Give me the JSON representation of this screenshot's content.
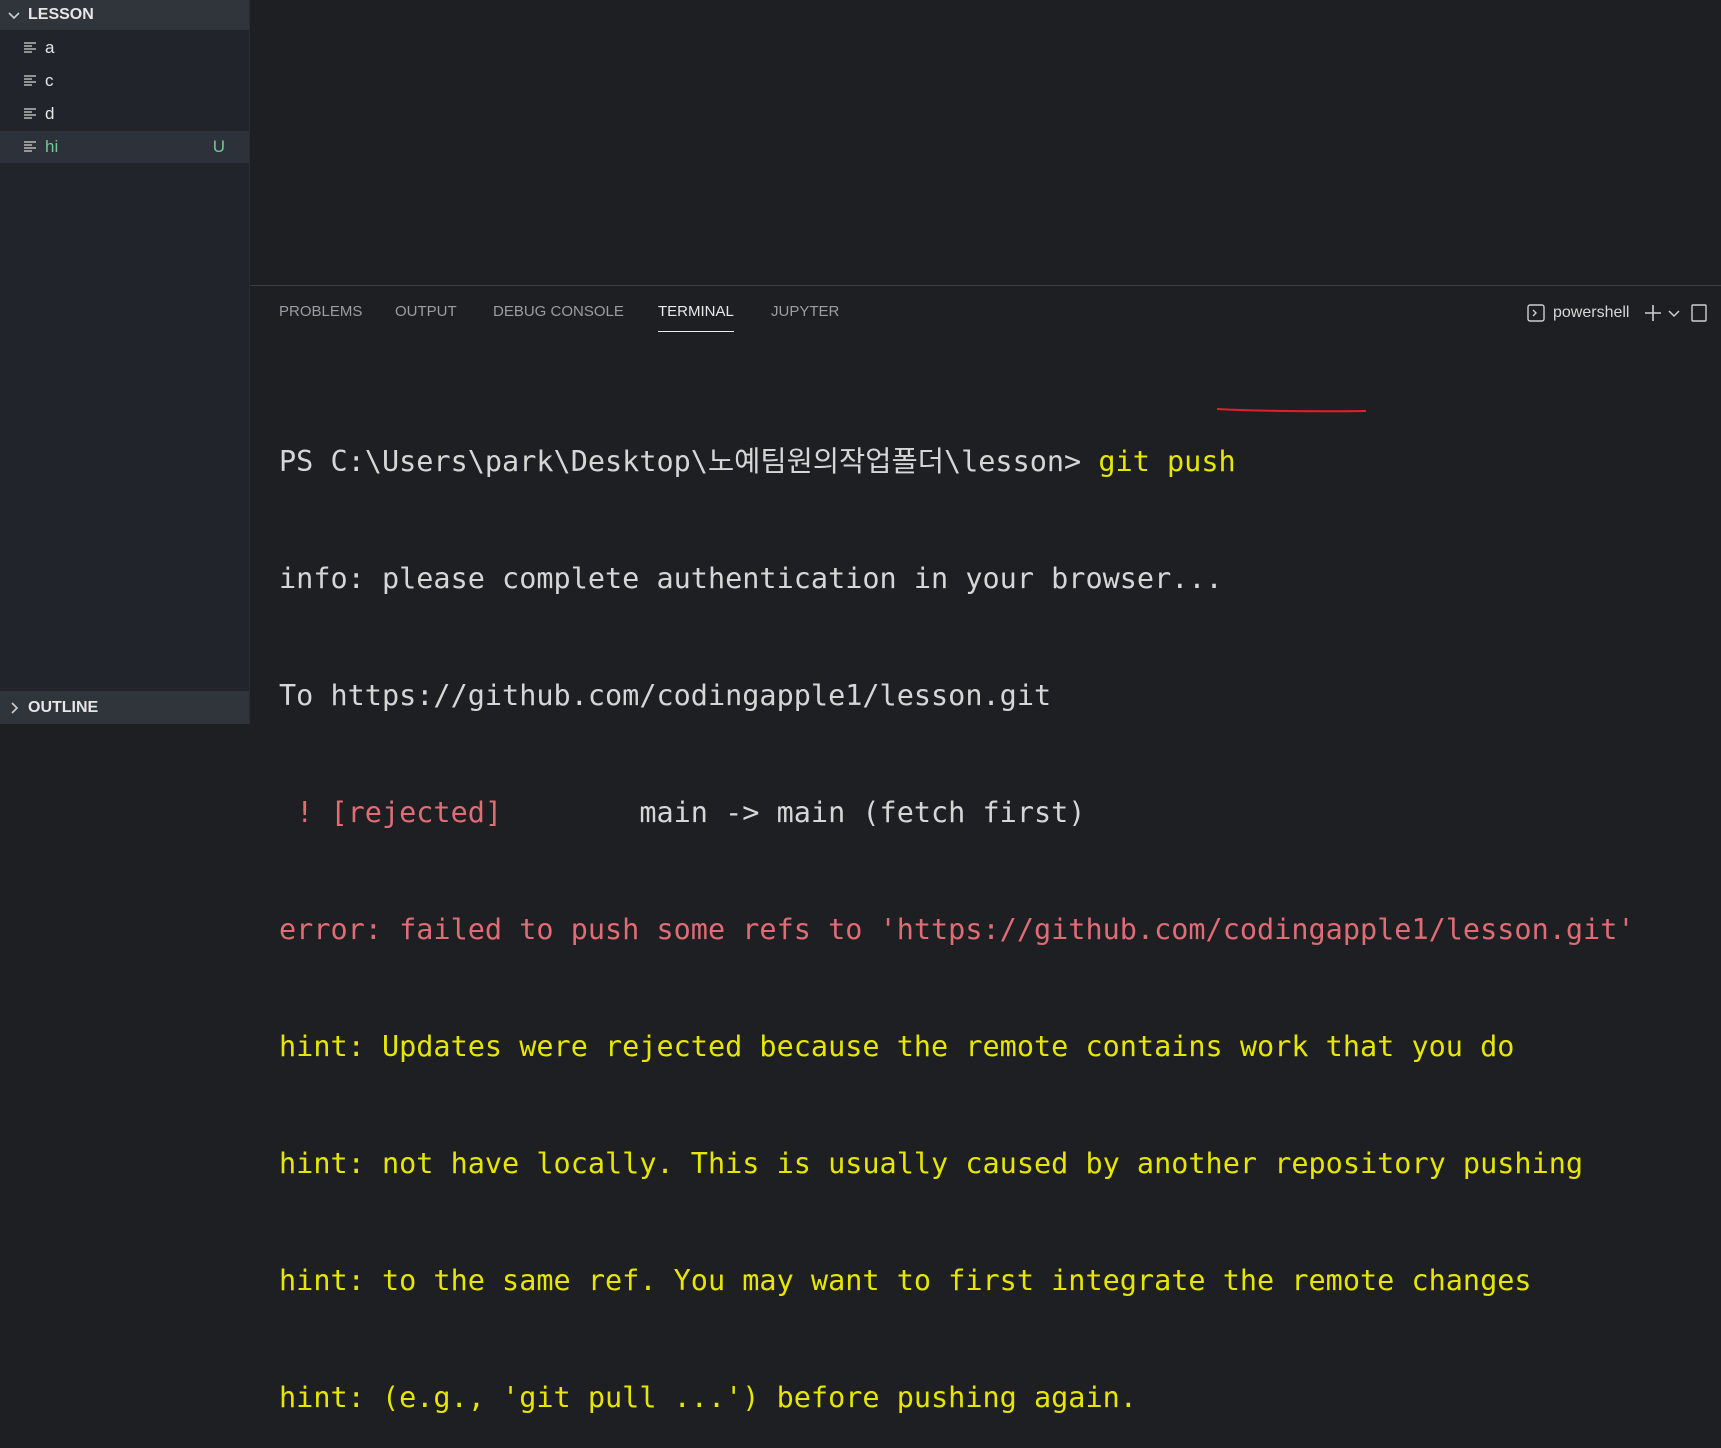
{
  "sidebar": {
    "folder": "LESSON",
    "files": [
      {
        "name": "a",
        "badge": ""
      },
      {
        "name": "c",
        "badge": ""
      },
      {
        "name": "d",
        "badge": ""
      },
      {
        "name": "hi",
        "badge": "U"
      }
    ],
    "outline": "OUTLINE"
  },
  "panel": {
    "tabs": [
      "PROBLEMS",
      "OUTPUT",
      "DEBUG CONSOLE",
      "TERMINAL",
      "JUPYTER"
    ],
    "active_tab": "TERMINAL",
    "shell": "powershell"
  },
  "terminal": {
    "prompt": "PS C:\\Users\\park\\Desktop\\노예팀원의작업폴더\\lesson> ",
    "command": "git push",
    "lines": [
      "info: please complete authentication in your browser...",
      "To https://github.com/codingapple1/lesson.git"
    ],
    "rejected_mark": " ! [rejected]",
    "rejected_rest": "        main -> main (fetch first)",
    "error": "error: failed to push some refs to 'https://github.com/codingapple1/lesson.git'",
    "hints": [
      "hint: Updates were rejected because the remote contains work that you do",
      "hint: not have locally. This is usually caused by another repository pushing",
      "hint: to the same ref. You may want to first integrate the remote changes",
      "hint: (e.g., 'git pull ...') before pushing again."
    ]
  },
  "colors": {
    "hint": "#e6e600",
    "error": "#e06c75",
    "untracked": "#73c991",
    "annotation": "#e0202a"
  }
}
